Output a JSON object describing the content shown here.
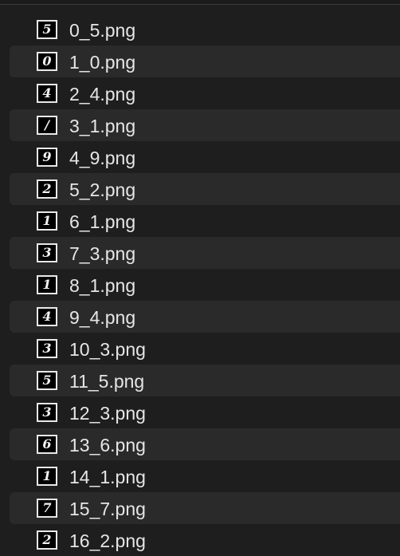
{
  "files": [
    {
      "name": "0_5.png",
      "thumb_digit": "5",
      "thumb_icon": "mnist-digit-5-thumbnail"
    },
    {
      "name": "1_0.png",
      "thumb_digit": "0",
      "thumb_icon": "mnist-digit-0-thumbnail"
    },
    {
      "name": "2_4.png",
      "thumb_digit": "4",
      "thumb_icon": "mnist-digit-4-thumbnail"
    },
    {
      "name": "3_1.png",
      "thumb_digit": "/",
      "thumb_icon": "mnist-digit-1-thumbnail"
    },
    {
      "name": "4_9.png",
      "thumb_digit": "9",
      "thumb_icon": "mnist-digit-9-thumbnail"
    },
    {
      "name": "5_2.png",
      "thumb_digit": "2",
      "thumb_icon": "mnist-digit-2-thumbnail"
    },
    {
      "name": "6_1.png",
      "thumb_digit": "1",
      "thumb_icon": "mnist-digit-1-thumbnail"
    },
    {
      "name": "7_3.png",
      "thumb_digit": "3",
      "thumb_icon": "mnist-digit-3-thumbnail"
    },
    {
      "name": "8_1.png",
      "thumb_digit": "1",
      "thumb_icon": "mnist-digit-1-thumbnail"
    },
    {
      "name": "9_4.png",
      "thumb_digit": "4",
      "thumb_icon": "mnist-digit-4-thumbnail"
    },
    {
      "name": "10_3.png",
      "thumb_digit": "3",
      "thumb_icon": "mnist-digit-3-thumbnail"
    },
    {
      "name": "11_5.png",
      "thumb_digit": "5",
      "thumb_icon": "mnist-digit-5-thumbnail"
    },
    {
      "name": "12_3.png",
      "thumb_digit": "3",
      "thumb_icon": "mnist-digit-3-thumbnail"
    },
    {
      "name": "13_6.png",
      "thumb_digit": "6",
      "thumb_icon": "mnist-digit-6-thumbnail"
    },
    {
      "name": "14_1.png",
      "thumb_digit": "1",
      "thumb_icon": "mnist-digit-1-thumbnail"
    },
    {
      "name": "15_7.png",
      "thumb_digit": "7",
      "thumb_icon": "mnist-digit-7-thumbnail"
    },
    {
      "name": "16_2.png",
      "thumb_digit": "2",
      "thumb_icon": "mnist-digit-2-thumbnail"
    }
  ],
  "colors": {
    "background": "#1e1e1e",
    "alt_row": "#2a2a2a",
    "text": "#e6e6e6",
    "thumb_border": "#e8e8e8"
  }
}
